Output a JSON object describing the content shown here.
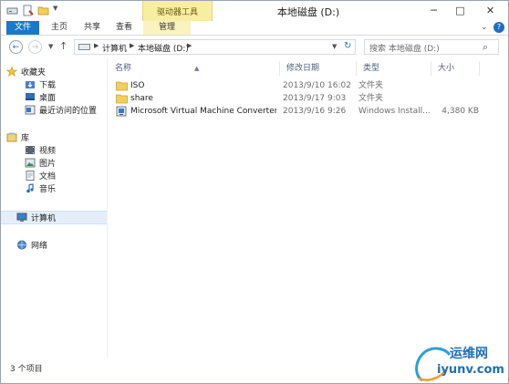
{
  "window": {
    "title": "本地磁盘 (D:)",
    "context_group": "驱动器工具",
    "controls": {
      "minimize": "─",
      "maximize": "□",
      "close": "✕"
    }
  },
  "ribbon": {
    "tabs": [
      "文件",
      "主页",
      "共享",
      "查看",
      "管理"
    ],
    "accent": "#1979ca",
    "context_color": "#f8eea3"
  },
  "address": {
    "segments": [
      "计算机",
      "本地磁盘 (D:)"
    ],
    "search_placeholder": "搜索 本地磁盘 (D:)"
  },
  "nav_pane": {
    "favorites": "收藏夹",
    "favorites_items": [
      "下载",
      "桌面",
      "最近访问的位置"
    ],
    "libraries": "库",
    "libraries_items": [
      "视频",
      "图片",
      "文档",
      "音乐"
    ],
    "computer": "计算机",
    "network": "网络"
  },
  "file_list": {
    "columns": [
      "名称",
      "修改日期",
      "类型",
      "大小"
    ],
    "rows": [
      {
        "name": "ISO",
        "date": "2013/9/10 16:02",
        "type": "文件夹",
        "size": "",
        "icon": "folder-icon"
      },
      {
        "name": "share",
        "date": "2013/9/17 9:03",
        "type": "文件夹",
        "size": "",
        "icon": "folder-icon"
      },
      {
        "name": "Microsoft Virtual Machine Converter ...",
        "date": "2013/9/16 9:26",
        "type": "Windows Install...",
        "size": "4,380 KB",
        "icon": "installer-icon"
      }
    ]
  },
  "status": {
    "count": "3 个项目"
  },
  "watermark": {
    "brand_cn": "运维网",
    "domain": "iyunv.com"
  }
}
